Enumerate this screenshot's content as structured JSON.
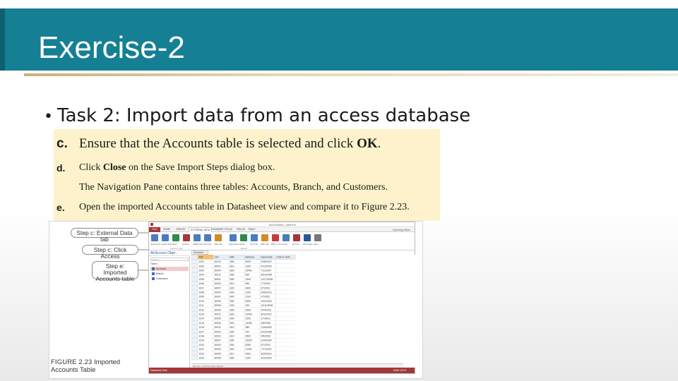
{
  "slide": {
    "title": "Exercise-2",
    "bullet": "Task 2: Import data from an access database"
  },
  "instructions": [
    {
      "letter": "c.",
      "parts": [
        {
          "t": "Ensure that the Accounts table is selected and click "
        },
        {
          "t": "OK",
          "b": true
        },
        {
          "t": "."
        }
      ]
    },
    {
      "letter": "d.",
      "parts": [
        {
          "t": "Click "
        },
        {
          "t": "Close",
          "b": true
        },
        {
          "t": " on the Save Import Steps dialog box."
        }
      ]
    },
    {
      "letter": "",
      "parts": [
        {
          "t": "The Navigation Pane contains three tables: Accounts, Branch, and Customers."
        }
      ]
    },
    {
      "letter": "e.",
      "parts": [
        {
          "t": "Open the imported Accounts table in Datasheet view and compare it to Figure 2.23."
        }
      ]
    }
  ],
  "figure": {
    "callouts": [
      "Step c: External Data tab",
      "Step c: Click Access",
      "Step e: Imported Accounts table"
    ],
    "caption_bold": "FIGURE 2.23",
    "caption_line1": " Imported",
    "caption_line2": "Accounts Table"
  },
  "window": {
    "title": "a02h1Bank_LastFirst",
    "user": "Exploring Series",
    "tabs": [
      "FILE",
      "HOME",
      "CREATE",
      "EXTERNAL DATA",
      "DATABASE TOOLS",
      "FIELDS",
      "TABLE"
    ],
    "ribbon_buttons": [
      "Saved Imports",
      "Linked Table Manager",
      "Excel",
      "Access",
      "ODBC Database",
      "Text File",
      "XML File",
      "Saved Exports",
      "Excel",
      "Text File",
      "XML File",
      "PDF or XPS",
      "Email",
      "Access",
      "Word Merge",
      "More"
    ],
    "ribbon_groups": [
      "Import & Link",
      "Export"
    ],
    "nav_title": "All Access Obje...",
    "nav_search": "Search...",
    "nav_group": "Tables",
    "nav_items": [
      "Accounts",
      "Branch",
      "Customers"
    ],
    "doc_tab": "Accounts",
    "columns": [
      "AID",
      "CID",
      "BID",
      "Balance",
      "OpenDate",
      "Click to Add"
    ],
    "rows": [
      [
        "1001",
        "30010",
        "B50",
        "5000",
        "4/28/2012"
      ],
      [
        "1002",
        "30001",
        "B10",
        "1200",
        "4/13/2009"
      ],
      [
        "1003",
        "30004",
        "B20",
        "15490",
        "7/11/2007"
      ],
      [
        "1004",
        "30011",
        "B50",
        "630",
        "8/31/2008"
      ],
      [
        "1005",
        "30001",
        "B50",
        "1300",
        "11/17/2006"
      ],
      [
        "1006",
        "30005",
        "B10",
        "550",
        "7/7/2002"
      ],
      [
        "1007",
        "30007",
        "B20",
        "3400",
        "6/7/2011"
      ],
      [
        "1008",
        "30002",
        "B40",
        "2100",
        "9/30/2012"
      ],
      [
        "1009",
        "30001",
        "B40",
        "2100",
        "2/7/2011"
      ],
      [
        "1010",
        "30005",
        "B30",
        "5000",
        "3/22/2003"
      ],
      [
        "1011",
        "30006",
        "B30",
        "230",
        "10/11/2006"
      ],
      [
        "1012",
        "30003",
        "B50",
        "2930",
        "9/14/2011"
      ],
      [
        "1013",
        "30011",
        "B20",
        "10000",
        "8/12/2012"
      ],
      [
        "1014",
        "30005",
        "B40",
        "1000",
        "1/7/2012"
      ],
      [
        "1015",
        "30004",
        "B40",
        "14250",
        "4/8/2008"
      ],
      [
        "1016",
        "30011",
        "B10",
        "380",
        "11/6/2008"
      ],
      [
        "1017",
        "30002",
        "B30",
        "190",
        "6/12/2008"
      ],
      [
        "1018",
        "30001",
        "B10",
        "3500",
        "5/5/2008"
      ],
      [
        "1019",
        "30007",
        "B50",
        "15300",
        "3/10/2004"
      ],
      [
        "1020",
        "30004",
        "B30",
        "8250",
        "9/7/2010"
      ],
      [
        "1021",
        "30003",
        "B40",
        "11000",
        "7/17/2010"
      ],
      [
        "1022",
        "30005",
        "B10",
        "4000",
        "8/24/2014"
      ],
      [
        "1023",
        "30009",
        "B50",
        "1200",
        "8/10/2004"
      ]
    ],
    "record_nav": "Record: 1 of 23  No Filter  Search",
    "status_left": "Datasheet View",
    "status_right": "NUM LOCK"
  },
  "colors": {
    "banner": "#157f94",
    "instruction_box": "#fdf2cb",
    "access_accent": "#a4373a",
    "nav_selected": "#f6c9ca"
  }
}
